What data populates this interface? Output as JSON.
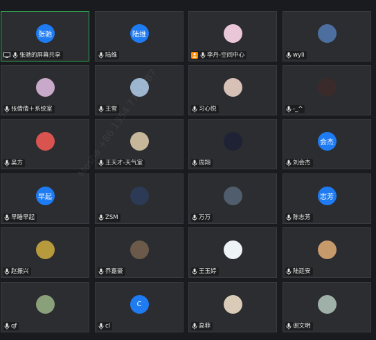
{
  "watermark": "Mosha +86 1354 7751387",
  "tiles": [
    {
      "name": "张驰的屏幕共享",
      "avatar_text": "张驰",
      "avatar_type": "text",
      "icon": "screen-share-icon",
      "active": true
    },
    {
      "name": "陆维",
      "avatar_text": "陆维",
      "avatar_type": "text"
    },
    {
      "name": "李丹-空间中心",
      "avatar_type": "img",
      "avatar_color": "#e9c7d8",
      "icon": "host-badge-icon"
    },
    {
      "name": "wyli",
      "avatar_type": "img",
      "avatar_color": "#4d6fa0"
    },
    {
      "name": "张倩倩＋系统室",
      "avatar_type": "img",
      "avatar_color": "#c9a9c9"
    },
    {
      "name": "王雪",
      "avatar_type": "img",
      "avatar_color": "#9db6cf"
    },
    {
      "name": "习心悦",
      "avatar_type": "img",
      "avatar_color": "#d7c1b7"
    },
    {
      "name": "-_^",
      "avatar_type": "img",
      "avatar_color": "#3b2a2a"
    },
    {
      "name": "吴方",
      "avatar_type": "img",
      "avatar_color": "#d9534f"
    },
    {
      "name": "王天才-天气室",
      "avatar_type": "img",
      "avatar_color": "#c7b79a"
    },
    {
      "name": "周翔",
      "avatar_type": "img",
      "avatar_color": "#1f2235"
    },
    {
      "name": "刘会杰",
      "avatar_text": "会杰",
      "avatar_type": "text"
    },
    {
      "name": "早睡早起",
      "avatar_text": "早起",
      "avatar_type": "text"
    },
    {
      "name": "ZSM",
      "avatar_type": "img",
      "avatar_color": "#2c3a55"
    },
    {
      "name": "万万",
      "avatar_type": "img",
      "avatar_color": "#4f5d6c"
    },
    {
      "name": "陈志芳",
      "avatar_text": "志芳",
      "avatar_type": "text"
    },
    {
      "name": "赵振兴",
      "avatar_type": "img",
      "avatar_color": "#b79a3c"
    },
    {
      "name": "乔嘉豪",
      "avatar_type": "img",
      "avatar_color": "#6b5a4a"
    },
    {
      "name": "王玉婷",
      "avatar_type": "img",
      "avatar_color": "#eef3f7"
    },
    {
      "name": "陆廷安",
      "avatar_type": "img",
      "avatar_color": "#c79a6b"
    },
    {
      "name": "qf",
      "avatar_type": "img",
      "avatar_color": "#8aa07a"
    },
    {
      "name": "cl",
      "avatar_text": "C",
      "avatar_type": "text"
    },
    {
      "name": "高菲",
      "avatar_type": "img",
      "avatar_color": "#d9cbb7"
    },
    {
      "name": "谢文明",
      "avatar_type": "img",
      "avatar_color": "#9fb0a8"
    }
  ]
}
